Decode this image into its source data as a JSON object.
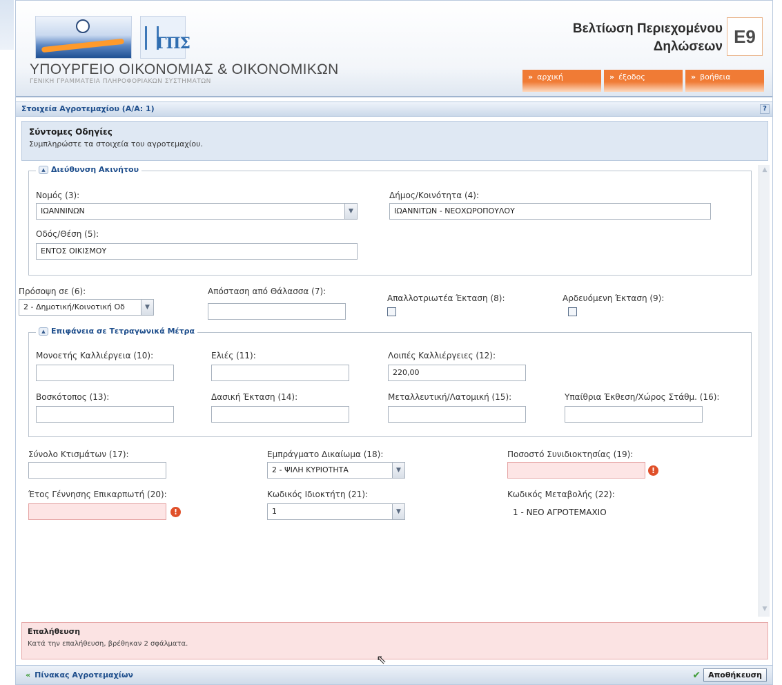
{
  "header": {
    "ministry": "ΥΠΟΥΡΓΕΙΟ ΟΙΚΟΝΟΜΙΑΣ & ΟΙΚΟΝΟΜΙΚΩΝ",
    "gsis_sub": "ΓΕΝΙΚΗ ΓΡΑΜΜΑΤΕΙΑ ΠΛΗΡΟΦΟΡΙΑΚΩΝ ΣΥΣΤΗΜΑΤΩΝ",
    "app_title_line1": "Βελτίωση Περιεχομένου",
    "app_title_line2": "Δηλώσεων",
    "badge": "E9",
    "gsis_logo_text": "ΓΠΣ",
    "nav": {
      "home": "αρχική",
      "exit": "έξοδος",
      "help": "βοήθεια"
    }
  },
  "section": {
    "title": "Στοιχεία Αγροτεμαχίου (Α/Α: 1)",
    "help": "?"
  },
  "instructions": {
    "title": "Σύντομες Οδηγίες",
    "text": "Συμπληρώστε τα στοιχεία του αγροτεμαχίου."
  },
  "address": {
    "legend": "Διεύθυνση Ακινήτου",
    "prefecture": {
      "label": "Νομός (3):",
      "value": "ΙΩΑΝΝΙΝΩΝ"
    },
    "municipality": {
      "label": "Δήμος/Κοινότητα (4):",
      "value": "ΙΩΑΝΝΙΤΩΝ - ΝΕΟΧΩΡΟΠΟΥΛΟΥ"
    },
    "street": {
      "label": "Οδός/Θέση (5):",
      "value": "ΕΝΤΟΣ ΟΙΚΙΣΜΟΥ"
    }
  },
  "row1": {
    "frontage": {
      "label": "Πρόσοψη σε (6):",
      "value": "2 - Δημοτική/Κοινοτική Οδ"
    },
    "sea_distance": {
      "label": "Απόσταση από Θάλασσα (7):",
      "value": ""
    },
    "expropriated": {
      "label": "Απαλλοτριωτέα Έκταση (8):"
    },
    "irrigated": {
      "label": "Αρδευόμενη Έκταση (9):"
    }
  },
  "surface": {
    "legend": "Επιφάνεια σε Τετραγωνικά Μέτρα",
    "mono": {
      "label": "Μονοετής Καλλιέργεια (10):",
      "value": ""
    },
    "olives": {
      "label": "Ελιές (11):",
      "value": ""
    },
    "other": {
      "label": "Λοιπές Καλλιέργειες (12):",
      "value": "220,00"
    },
    "pasture": {
      "label": "Βοσκότοπος (13):",
      "value": ""
    },
    "forest": {
      "label": "Δασική Έκταση (14):",
      "value": ""
    },
    "mining": {
      "label": "Μεταλλευτική/Λατομική (15):",
      "value": ""
    },
    "outdoor": {
      "label": "Υπαίθρια Έκθεση/Χώρος Στάθμ. (16):",
      "value": ""
    }
  },
  "row2": {
    "buildings": {
      "label": "Σύνολο Κτισμάτων (17):",
      "value": ""
    },
    "right": {
      "label": "Εμπράγματο Δικαίωμα (18):",
      "value": "2 - ΨΙΛΗ ΚΥΡΙΟΤΗΤΑ"
    },
    "percentage": {
      "label": "Ποσοστό Συνιδιοκτησίας (19):",
      "value": ""
    },
    "birth_year": {
      "label": "Έτος Γέννησης Επικαρπωτή (20):",
      "value": ""
    },
    "owner_code": {
      "label": "Κωδικός Ιδιοκτήτη (21):",
      "value": "1"
    },
    "change_code": {
      "label": "Κωδικός Μεταβολής (22):",
      "value": "1 - ΝΕΟ ΑΓΡΟΤΕΜΑΧΙΟ"
    }
  },
  "validation": {
    "title": "Επαλήθευση",
    "text": "Κατά την επαλήθευση, βρέθηκαν 2 σφάλματα."
  },
  "footer": {
    "back": "Πίνακας Αγροτεμαχίων",
    "save": "Αποθήκευση"
  },
  "colors": {
    "accent": "#1e4e8c",
    "nav_orange": "#f07b35",
    "error_bg": "#fde5e5",
    "error_icon": "#e0502a"
  }
}
